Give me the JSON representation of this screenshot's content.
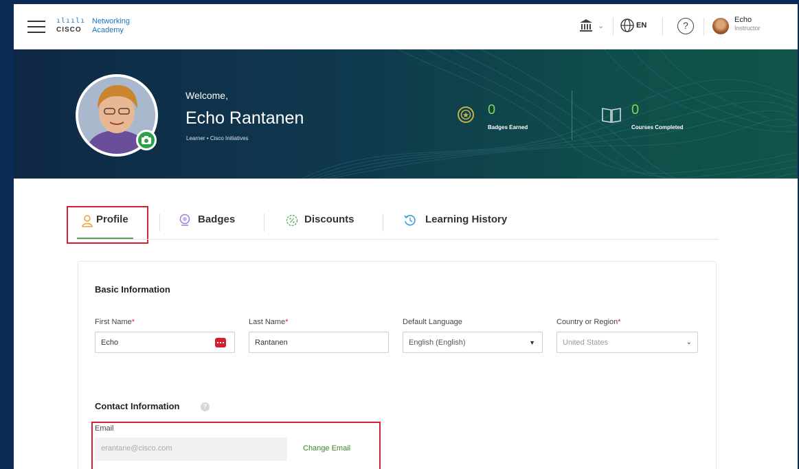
{
  "header": {
    "logo_bars": "ılıılı",
    "logo_cisco": "CISCO",
    "logo_line1": "Networking",
    "logo_line2": "Academy",
    "institution_icon": "institution-building-icon",
    "chevron_icon": "chevron-down-icon",
    "globe_icon": "globe-icon",
    "language": "EN",
    "help_glyph": "?",
    "user": {
      "name": "Echo",
      "role": "Instructor"
    }
  },
  "hero": {
    "welcome": "Welcome,",
    "full_name": "Echo Rantanen",
    "sub_role": "Learner  •  Cisco Initiatives",
    "stats": [
      {
        "icon": "badge-icon",
        "value": "0",
        "label": "Badges Earned"
      },
      {
        "icon": "book-icon",
        "value": "0",
        "label": "Courses Completed"
      }
    ]
  },
  "tabs": [
    {
      "label": "Profile",
      "icon": "user-icon",
      "active": true
    },
    {
      "label": "Badges",
      "icon": "badge-icon",
      "active": false
    },
    {
      "label": "Discounts",
      "icon": "discount-icon",
      "active": false
    },
    {
      "label": "Learning History",
      "icon": "history-icon",
      "active": false
    }
  ],
  "basic_info": {
    "title": "Basic Information",
    "first_name": {
      "label": "First Name",
      "required": "*",
      "value": "Echo"
    },
    "last_name": {
      "label": "Last Name",
      "required": "*",
      "value": "Rantanen"
    },
    "default_language": {
      "label": "Default Language",
      "value": "English (English)"
    },
    "country": {
      "label": "Country or Region",
      "required": "*",
      "value": "United States"
    }
  },
  "contact_info": {
    "title": "Contact Information",
    "info_glyph": "?",
    "email": {
      "label": "Email",
      "value": "erantane@cisco.com",
      "change_label": "Change Email"
    }
  },
  "colors": {
    "accent_green": "#5e9e5c",
    "highlight_red": "#d2202f",
    "stat_green": "#7fd64e",
    "page_border": "#0b2a55"
  }
}
